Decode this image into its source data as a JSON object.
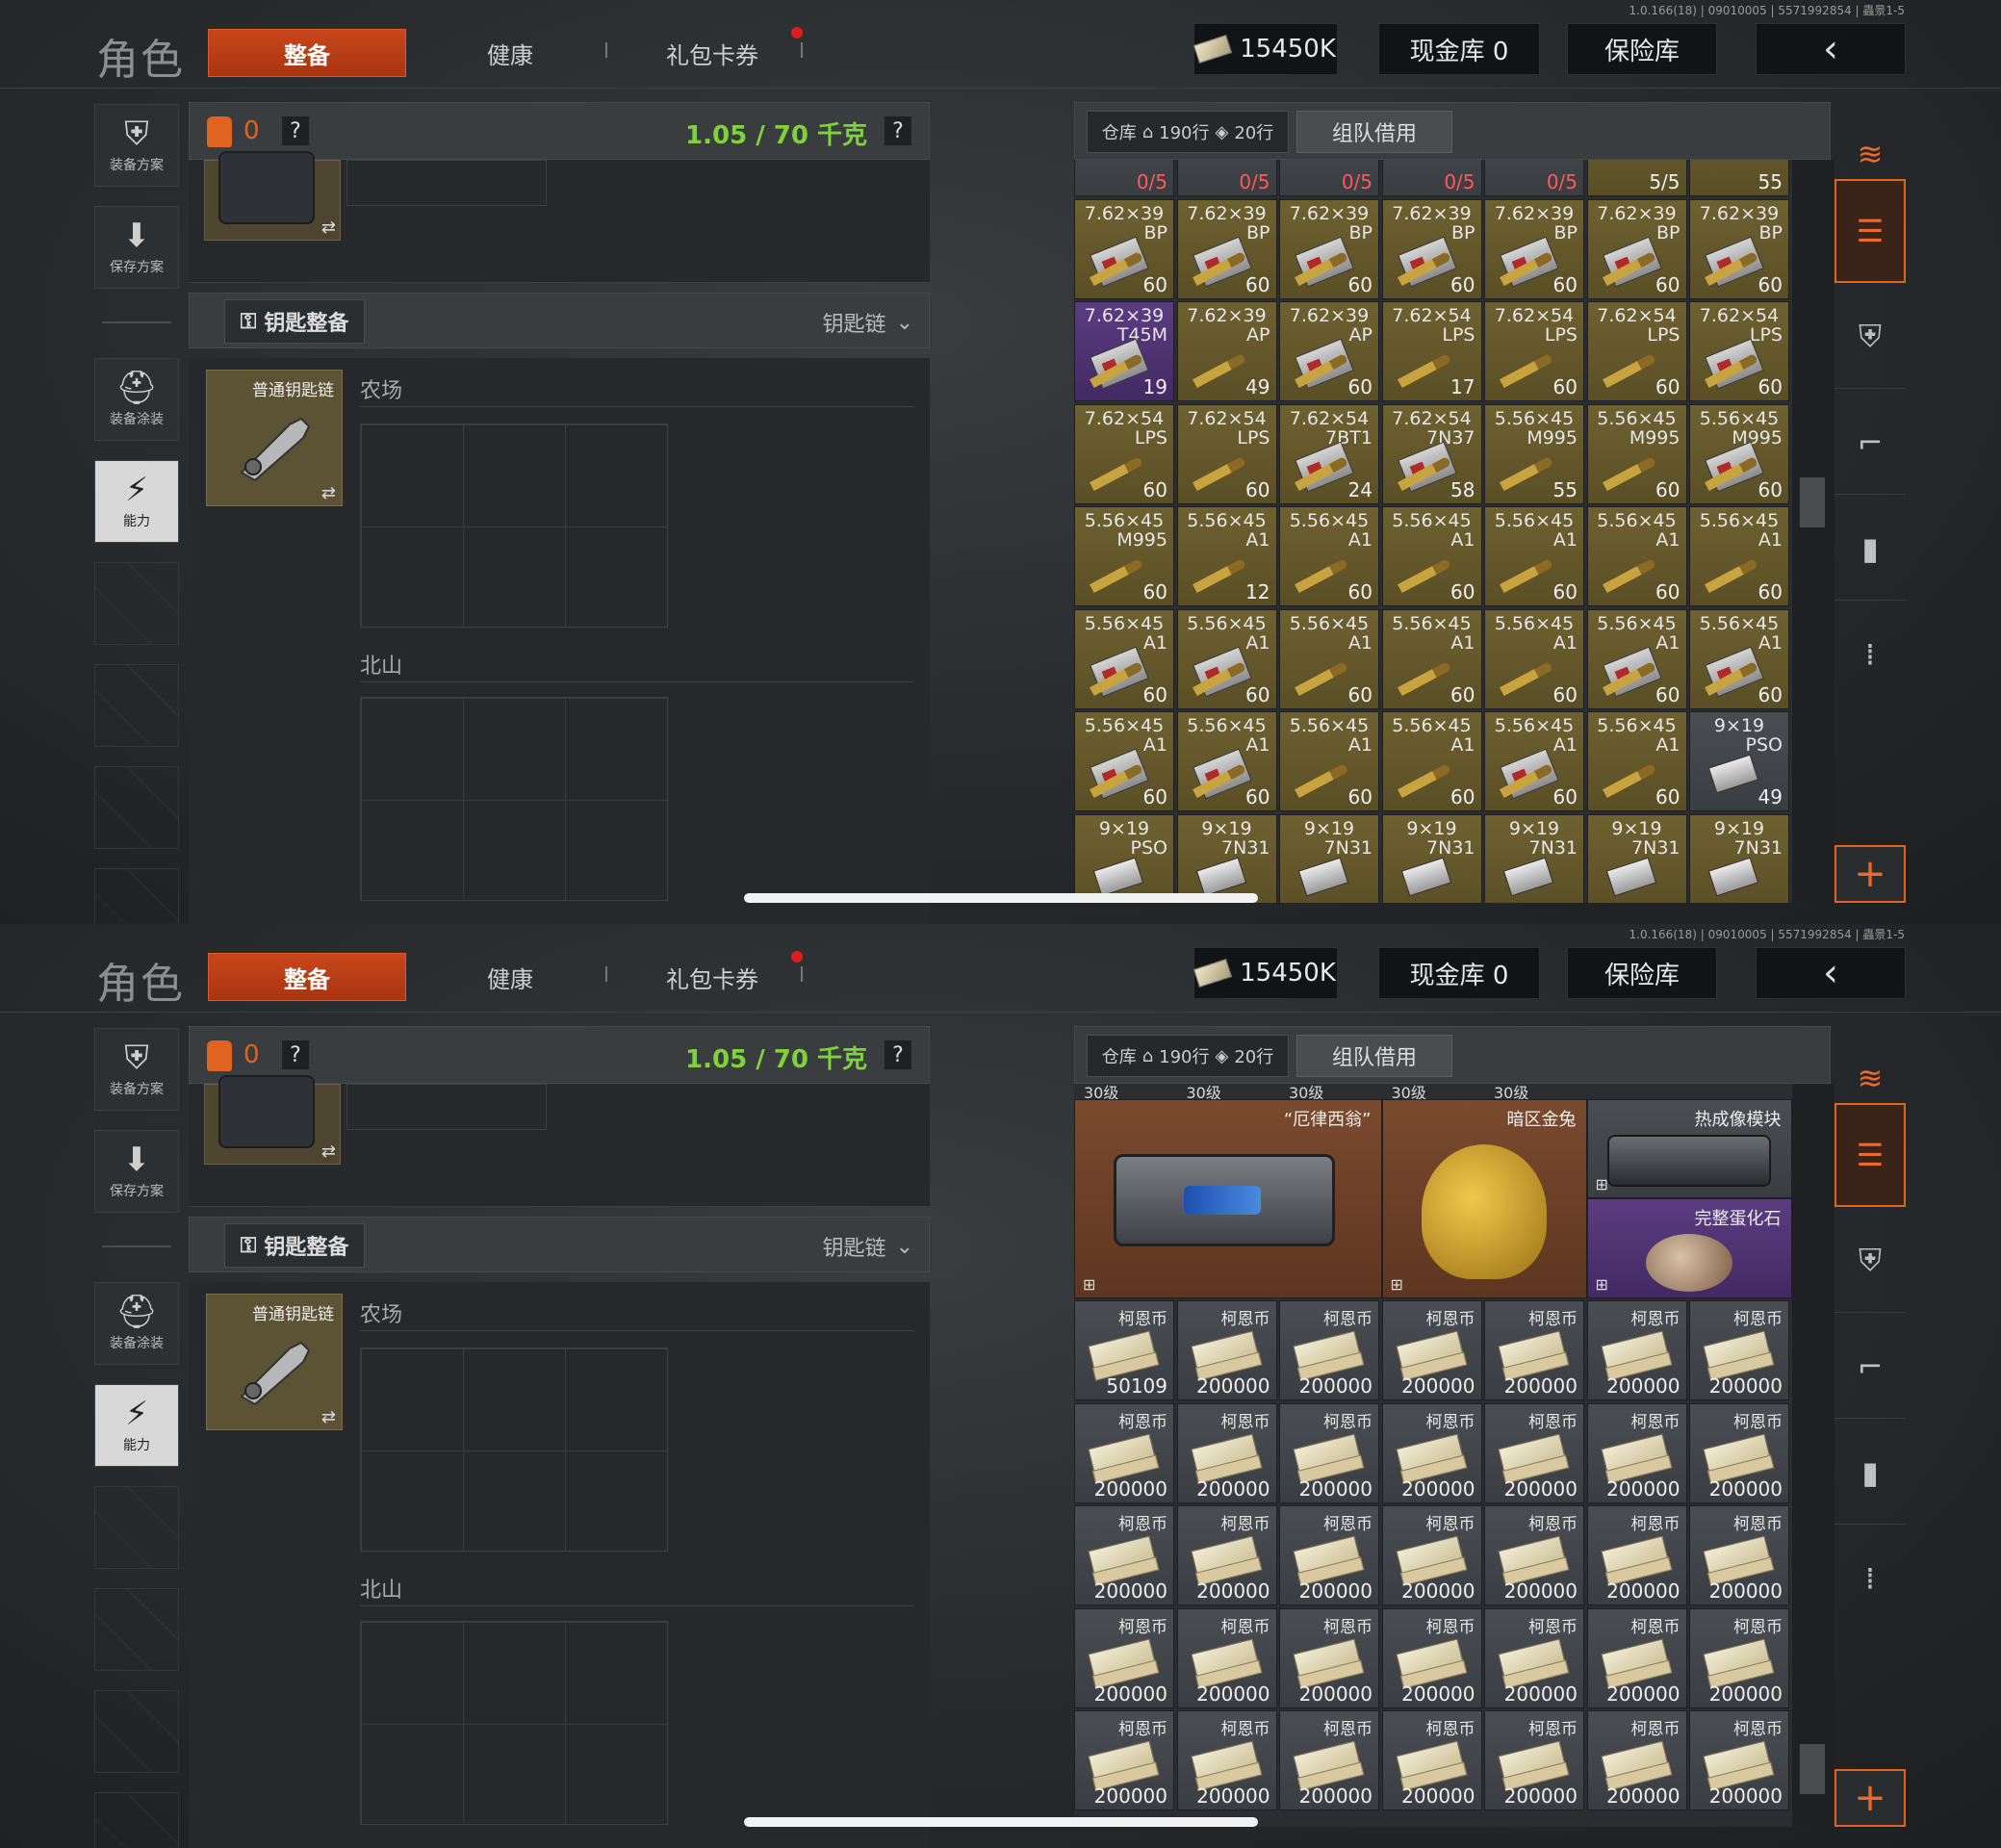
{
  "screens": [
    {
      "version": "1.0.166(18) | 09010005 | 5571992854 | 蟲景1-5",
      "title": "角色",
      "tabs": {
        "equip": "整备",
        "health": "健康",
        "gift": "礼包卡券"
      },
      "money": "15450K",
      "cash_vault": "现金库 0",
      "safe": "保险库",
      "back_icon": "‹",
      "sidebar": {
        "equip_plan": "装备方案",
        "save_plan": "保存方案",
        "equip_paint": "装备涂装",
        "ability": "能力"
      },
      "backpack": {
        "count": "0",
        "help": "?",
        "weight": "1.05 / 70 千克",
        "weight_help": "?"
      },
      "keys": {
        "title": "钥匙整备",
        "chain": "钥匙链",
        "item_label": "普通钥匙链",
        "zone_1": "农场",
        "zone_2": "北山"
      },
      "warehouse": {
        "tab": "仓库",
        "rows_a": "190行",
        "rows_b": "20行",
        "borrow": "组队借用"
      },
      "grid_rows": [
        {
          "partial": true,
          "cells": [
            {
              "q": "0/5",
              "kind": "partial",
              "color": "gray"
            },
            {
              "q": "0/5",
              "kind": "partial",
              "color": "gray"
            },
            {
              "q": "0/5",
              "kind": "partial",
              "color": "gray"
            },
            {
              "q": "0/5",
              "kind": "partial",
              "color": "gray"
            },
            {
              "q": "0/5",
              "kind": "partial",
              "color": "gray"
            },
            {
              "q": "5/5",
              "kind": "partial",
              "color": "gold"
            },
            {
              "q": "55",
              "kind": "partial",
              "color": "gold"
            }
          ]
        },
        {
          "cells": [
            {
              "cal": "7.62×39",
              "typ": "BP",
              "q": "60",
              "kind": "box",
              "color": "gold"
            },
            {
              "cal": "7.62×39",
              "typ": "BP",
              "q": "60",
              "kind": "box",
              "color": "gold"
            },
            {
              "cal": "7.62×39",
              "typ": "BP",
              "q": "60",
              "kind": "box",
              "color": "gold"
            },
            {
              "cal": "7.62×39",
              "typ": "BP",
              "q": "60",
              "kind": "box",
              "color": "gold"
            },
            {
              "cal": "7.62×39",
              "typ": "BP",
              "q": "60",
              "kind": "box",
              "color": "gold"
            },
            {
              "cal": "7.62×39",
              "typ": "BP",
              "q": "60",
              "kind": "box",
              "color": "gold"
            },
            {
              "cal": "7.62×39",
              "typ": "BP",
              "q": "60",
              "kind": "box",
              "color": "gold"
            }
          ]
        },
        {
          "cells": [
            {
              "cal": "7.62×39",
              "typ": "T45M",
              "q": "19",
              "kind": "box",
              "color": "purple"
            },
            {
              "cal": "7.62×39",
              "typ": "AP",
              "q": "49",
              "kind": "bullet",
              "color": "gold"
            },
            {
              "cal": "7.62×39",
              "typ": "AP",
              "q": "60",
              "kind": "box",
              "color": "gold"
            },
            {
              "cal": "7.62×54",
              "typ": "LPS",
              "q": "17",
              "kind": "bullet",
              "color": "gold"
            },
            {
              "cal": "7.62×54",
              "typ": "LPS",
              "q": "60",
              "kind": "bullet",
              "color": "gold"
            },
            {
              "cal": "7.62×54",
              "typ": "LPS",
              "q": "60",
              "kind": "bullet",
              "color": "gold"
            },
            {
              "cal": "7.62×54",
              "typ": "LPS",
              "q": "60",
              "kind": "box",
              "color": "gold"
            }
          ]
        },
        {
          "cells": [
            {
              "cal": "7.62×54",
              "typ": "LPS",
              "q": "60",
              "kind": "bullet",
              "color": "gold"
            },
            {
              "cal": "7.62×54",
              "typ": "LPS",
              "q": "60",
              "kind": "bullet",
              "color": "gold"
            },
            {
              "cal": "7.62×54",
              "typ": "7BT1",
              "q": "24",
              "kind": "box",
              "color": "gold"
            },
            {
              "cal": "7.62×54",
              "typ": "7N37",
              "q": "58",
              "kind": "box",
              "color": "gold"
            },
            {
              "cal": "5.56×45",
              "typ": "M995",
              "q": "55",
              "kind": "bullet",
              "color": "gold"
            },
            {
              "cal": "5.56×45",
              "typ": "M995",
              "q": "60",
              "kind": "bullet",
              "color": "gold"
            },
            {
              "cal": "5.56×45",
              "typ": "M995",
              "q": "60",
              "kind": "box",
              "color": "gold"
            }
          ]
        },
        {
          "cells": [
            {
              "cal": "5.56×45",
              "typ": "M995",
              "q": "60",
              "kind": "bullet",
              "color": "gold"
            },
            {
              "cal": "5.56×45",
              "typ": "A1",
              "q": "12",
              "kind": "bullet",
              "color": "gold"
            },
            {
              "cal": "5.56×45",
              "typ": "A1",
              "q": "60",
              "kind": "bullet",
              "color": "gold"
            },
            {
              "cal": "5.56×45",
              "typ": "A1",
              "q": "60",
              "kind": "bullet",
              "color": "gold"
            },
            {
              "cal": "5.56×45",
              "typ": "A1",
              "q": "60",
              "kind": "bullet",
              "color": "gold"
            },
            {
              "cal": "5.56×45",
              "typ": "A1",
              "q": "60",
              "kind": "bullet",
              "color": "gold"
            },
            {
              "cal": "5.56×45",
              "typ": "A1",
              "q": "60",
              "kind": "bullet",
              "color": "gold"
            }
          ]
        },
        {
          "cells": [
            {
              "cal": "5.56×45",
              "typ": "A1",
              "q": "60",
              "kind": "box",
              "color": "gold"
            },
            {
              "cal": "5.56×45",
              "typ": "A1",
              "q": "60",
              "kind": "box",
              "color": "gold"
            },
            {
              "cal": "5.56×45",
              "typ": "A1",
              "q": "60",
              "kind": "bullet",
              "color": "gold"
            },
            {
              "cal": "5.56×45",
              "typ": "A1",
              "q": "60",
              "kind": "bullet",
              "color": "gold"
            },
            {
              "cal": "5.56×45",
              "typ": "A1",
              "q": "60",
              "kind": "bullet",
              "color": "gold"
            },
            {
              "cal": "5.56×45",
              "typ": "A1",
              "q": "60",
              "kind": "box",
              "color": "gold"
            },
            {
              "cal": "5.56×45",
              "typ": "A1",
              "q": "60",
              "kind": "box",
              "color": "gold"
            }
          ]
        },
        {
          "cells": [
            {
              "cal": "5.56×45",
              "typ": "A1",
              "q": "60",
              "kind": "box",
              "color": "gold"
            },
            {
              "cal": "5.56×45",
              "typ": "A1",
              "q": "60",
              "kind": "box",
              "color": "gold"
            },
            {
              "cal": "5.56×45",
              "typ": "A1",
              "q": "60",
              "kind": "bullet",
              "color": "gold"
            },
            {
              "cal": "5.56×45",
              "typ": "A1",
              "q": "60",
              "kind": "bullet",
              "color": "gold"
            },
            {
              "cal": "5.56×45",
              "typ": "A1",
              "q": "60",
              "kind": "box",
              "color": "gold"
            },
            {
              "cal": "5.56×45",
              "typ": "A1",
              "q": "60",
              "kind": "bullet",
              "color": "gold"
            },
            {
              "cal": "9×19",
              "typ": "PSO",
              "q": "49",
              "kind": "pistol",
              "color": "gray"
            }
          ]
        },
        {
          "cells": [
            {
              "cal": "9×19",
              "typ": "PSO",
              "q": "",
              "kind": "pistol",
              "color": "gold"
            },
            {
              "cal": "9×19",
              "typ": "7N31",
              "q": "",
              "kind": "pistol",
              "color": "gold"
            },
            {
              "cal": "9×19",
              "typ": "7N31",
              "q": "",
              "kind": "pistol",
              "color": "gold"
            },
            {
              "cal": "9×19",
              "typ": "7N31",
              "q": "",
              "kind": "pistol",
              "color": "gold"
            },
            {
              "cal": "9×19",
              "typ": "7N31",
              "q": "",
              "kind": "pistol",
              "color": "gold"
            },
            {
              "cal": "9×19",
              "typ": "7N31",
              "q": "",
              "kind": "pistol",
              "color": "gold"
            },
            {
              "cal": "9×19",
              "typ": "7N31",
              "q": "",
              "kind": "pistol",
              "color": "gold"
            }
          ]
        }
      ]
    },
    {
      "version": "1.0.166(18) | 09010005 | 5571992854 | 蟲景1-5",
      "title": "角色",
      "tabs": {
        "equip": "整备",
        "health": "健康",
        "gift": "礼包卡券"
      },
      "money": "15450K",
      "cash_vault": "现金库 0",
      "safe": "保险库",
      "back_icon": "‹",
      "sidebar": {
        "equip_plan": "装备方案",
        "save_plan": "保存方案",
        "equip_paint": "装备涂装",
        "ability": "能力"
      },
      "backpack": {
        "count": "0",
        "help": "?",
        "weight": "1.05 / 70 千克",
        "weight_help": "?"
      },
      "keys": {
        "title": "钥匙整备",
        "chain": "钥匙链",
        "item_label": "普通钥匙链",
        "zone_1": "农场",
        "zone_2": "北山"
      },
      "warehouse": {
        "tab": "仓库",
        "rows_a": "190行",
        "rows_b": "20行",
        "borrow": "组队借用"
      },
      "level_labels": [
        "30级",
        "30级",
        "30级",
        "30级",
        "30级"
      ],
      "featured": {
        "item_1": "“厄律西翁”",
        "item_2": "暗区金兔",
        "item_3": "热成像模块",
        "item_4": "完整蛋化石"
      },
      "coin_name": "柯恩币",
      "coin_rows": [
        [
          "50109",
          "200000",
          "200000",
          "200000",
          "200000",
          "200000",
          "200000"
        ],
        [
          "200000",
          "200000",
          "200000",
          "200000",
          "200000",
          "200000",
          "200000"
        ],
        [
          "200000",
          "200000",
          "200000",
          "200000",
          "200000",
          "200000",
          "200000"
        ],
        [
          "200000",
          "200000",
          "200000",
          "200000",
          "200000",
          "200000",
          "200000"
        ],
        [
          "200000",
          "200000",
          "200000",
          "200000",
          "200000",
          "200000",
          "200000"
        ]
      ]
    }
  ]
}
